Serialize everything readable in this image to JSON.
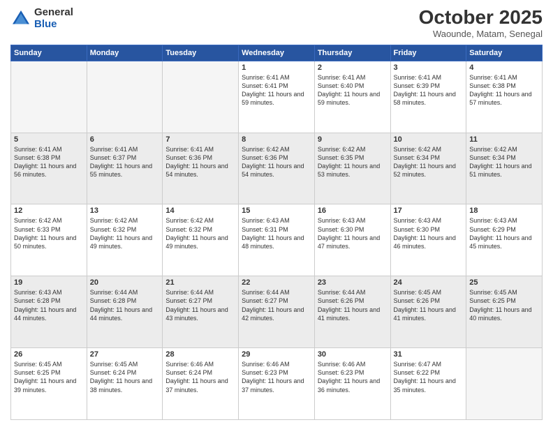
{
  "header": {
    "logo_general": "General",
    "logo_blue": "Blue",
    "month_title": "October 2025",
    "subtitle": "Waounde, Matam, Senegal"
  },
  "days_of_week": [
    "Sunday",
    "Monday",
    "Tuesday",
    "Wednesday",
    "Thursday",
    "Friday",
    "Saturday"
  ],
  "weeks": [
    {
      "shaded": false,
      "days": [
        {
          "num": "",
          "sunrise": "",
          "sunset": "",
          "daylight": ""
        },
        {
          "num": "",
          "sunrise": "",
          "sunset": "",
          "daylight": ""
        },
        {
          "num": "",
          "sunrise": "",
          "sunset": "",
          "daylight": ""
        },
        {
          "num": "1",
          "sunrise": "Sunrise: 6:41 AM",
          "sunset": "Sunset: 6:41 PM",
          "daylight": "Daylight: 11 hours and 59 minutes."
        },
        {
          "num": "2",
          "sunrise": "Sunrise: 6:41 AM",
          "sunset": "Sunset: 6:40 PM",
          "daylight": "Daylight: 11 hours and 59 minutes."
        },
        {
          "num": "3",
          "sunrise": "Sunrise: 6:41 AM",
          "sunset": "Sunset: 6:39 PM",
          "daylight": "Daylight: 11 hours and 58 minutes."
        },
        {
          "num": "4",
          "sunrise": "Sunrise: 6:41 AM",
          "sunset": "Sunset: 6:38 PM",
          "daylight": "Daylight: 11 hours and 57 minutes."
        }
      ]
    },
    {
      "shaded": true,
      "days": [
        {
          "num": "5",
          "sunrise": "Sunrise: 6:41 AM",
          "sunset": "Sunset: 6:38 PM",
          "daylight": "Daylight: 11 hours and 56 minutes."
        },
        {
          "num": "6",
          "sunrise": "Sunrise: 6:41 AM",
          "sunset": "Sunset: 6:37 PM",
          "daylight": "Daylight: 11 hours and 55 minutes."
        },
        {
          "num": "7",
          "sunrise": "Sunrise: 6:41 AM",
          "sunset": "Sunset: 6:36 PM",
          "daylight": "Daylight: 11 hours and 54 minutes."
        },
        {
          "num": "8",
          "sunrise": "Sunrise: 6:42 AM",
          "sunset": "Sunset: 6:36 PM",
          "daylight": "Daylight: 11 hours and 54 minutes."
        },
        {
          "num": "9",
          "sunrise": "Sunrise: 6:42 AM",
          "sunset": "Sunset: 6:35 PM",
          "daylight": "Daylight: 11 hours and 53 minutes."
        },
        {
          "num": "10",
          "sunrise": "Sunrise: 6:42 AM",
          "sunset": "Sunset: 6:34 PM",
          "daylight": "Daylight: 11 hours and 52 minutes."
        },
        {
          "num": "11",
          "sunrise": "Sunrise: 6:42 AM",
          "sunset": "Sunset: 6:34 PM",
          "daylight": "Daylight: 11 hours and 51 minutes."
        }
      ]
    },
    {
      "shaded": false,
      "days": [
        {
          "num": "12",
          "sunrise": "Sunrise: 6:42 AM",
          "sunset": "Sunset: 6:33 PM",
          "daylight": "Daylight: 11 hours and 50 minutes."
        },
        {
          "num": "13",
          "sunrise": "Sunrise: 6:42 AM",
          "sunset": "Sunset: 6:32 PM",
          "daylight": "Daylight: 11 hours and 49 minutes."
        },
        {
          "num": "14",
          "sunrise": "Sunrise: 6:42 AM",
          "sunset": "Sunset: 6:32 PM",
          "daylight": "Daylight: 11 hours and 49 minutes."
        },
        {
          "num": "15",
          "sunrise": "Sunrise: 6:43 AM",
          "sunset": "Sunset: 6:31 PM",
          "daylight": "Daylight: 11 hours and 48 minutes."
        },
        {
          "num": "16",
          "sunrise": "Sunrise: 6:43 AM",
          "sunset": "Sunset: 6:30 PM",
          "daylight": "Daylight: 11 hours and 47 minutes."
        },
        {
          "num": "17",
          "sunrise": "Sunrise: 6:43 AM",
          "sunset": "Sunset: 6:30 PM",
          "daylight": "Daylight: 11 hours and 46 minutes."
        },
        {
          "num": "18",
          "sunrise": "Sunrise: 6:43 AM",
          "sunset": "Sunset: 6:29 PM",
          "daylight": "Daylight: 11 hours and 45 minutes."
        }
      ]
    },
    {
      "shaded": true,
      "days": [
        {
          "num": "19",
          "sunrise": "Sunrise: 6:43 AM",
          "sunset": "Sunset: 6:28 PM",
          "daylight": "Daylight: 11 hours and 44 minutes."
        },
        {
          "num": "20",
          "sunrise": "Sunrise: 6:44 AM",
          "sunset": "Sunset: 6:28 PM",
          "daylight": "Daylight: 11 hours and 44 minutes."
        },
        {
          "num": "21",
          "sunrise": "Sunrise: 6:44 AM",
          "sunset": "Sunset: 6:27 PM",
          "daylight": "Daylight: 11 hours and 43 minutes."
        },
        {
          "num": "22",
          "sunrise": "Sunrise: 6:44 AM",
          "sunset": "Sunset: 6:27 PM",
          "daylight": "Daylight: 11 hours and 42 minutes."
        },
        {
          "num": "23",
          "sunrise": "Sunrise: 6:44 AM",
          "sunset": "Sunset: 6:26 PM",
          "daylight": "Daylight: 11 hours and 41 minutes."
        },
        {
          "num": "24",
          "sunrise": "Sunrise: 6:45 AM",
          "sunset": "Sunset: 6:26 PM",
          "daylight": "Daylight: 11 hours and 41 minutes."
        },
        {
          "num": "25",
          "sunrise": "Sunrise: 6:45 AM",
          "sunset": "Sunset: 6:25 PM",
          "daylight": "Daylight: 11 hours and 40 minutes."
        }
      ]
    },
    {
      "shaded": false,
      "days": [
        {
          "num": "26",
          "sunrise": "Sunrise: 6:45 AM",
          "sunset": "Sunset: 6:25 PM",
          "daylight": "Daylight: 11 hours and 39 minutes."
        },
        {
          "num": "27",
          "sunrise": "Sunrise: 6:45 AM",
          "sunset": "Sunset: 6:24 PM",
          "daylight": "Daylight: 11 hours and 38 minutes."
        },
        {
          "num": "28",
          "sunrise": "Sunrise: 6:46 AM",
          "sunset": "Sunset: 6:24 PM",
          "daylight": "Daylight: 11 hours and 37 minutes."
        },
        {
          "num": "29",
          "sunrise": "Sunrise: 6:46 AM",
          "sunset": "Sunset: 6:23 PM",
          "daylight": "Daylight: 11 hours and 37 minutes."
        },
        {
          "num": "30",
          "sunrise": "Sunrise: 6:46 AM",
          "sunset": "Sunset: 6:23 PM",
          "daylight": "Daylight: 11 hours and 36 minutes."
        },
        {
          "num": "31",
          "sunrise": "Sunrise: 6:47 AM",
          "sunset": "Sunset: 6:22 PM",
          "daylight": "Daylight: 11 hours and 35 minutes."
        },
        {
          "num": "",
          "sunrise": "",
          "sunset": "",
          "daylight": ""
        }
      ]
    }
  ]
}
